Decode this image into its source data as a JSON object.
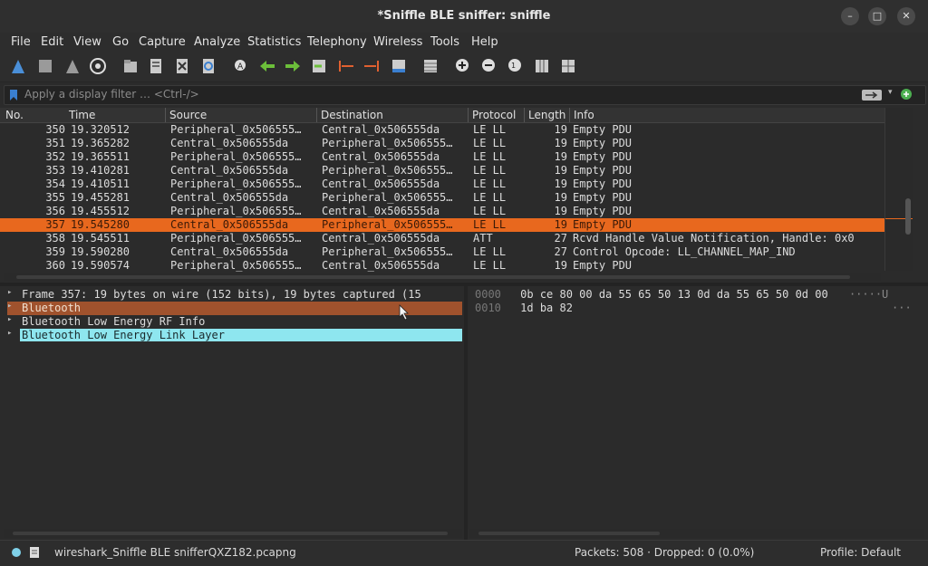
{
  "window": {
    "title": "*Sniffle BLE sniffer: sniffle"
  },
  "menu": [
    "File",
    "Edit",
    "View",
    "Go",
    "Capture",
    "Analyze",
    "Statistics",
    "Telephony",
    "Wireless",
    "Tools",
    "Help"
  ],
  "filter": {
    "placeholder": "Apply a display filter … <Ctrl-/>"
  },
  "columns": [
    "No.",
    "Time",
    "Source",
    "Destination",
    "Protocol",
    "Length",
    "Info"
  ],
  "packets": [
    {
      "no": "350",
      "time": "19.320512",
      "src": "Peripheral_0x506555…",
      "dst": "Central_0x506555da",
      "proto": "LE LL",
      "len": "19",
      "info": "Empty PDU"
    },
    {
      "no": "351",
      "time": "19.365282",
      "src": "Central_0x506555da",
      "dst": "Peripheral_0x506555…",
      "proto": "LE LL",
      "len": "19",
      "info": "Empty PDU"
    },
    {
      "no": "352",
      "time": "19.365511",
      "src": "Peripheral_0x506555…",
      "dst": "Central_0x506555da",
      "proto": "LE LL",
      "len": "19",
      "info": "Empty PDU"
    },
    {
      "no": "353",
      "time": "19.410281",
      "src": "Central_0x506555da",
      "dst": "Peripheral_0x506555…",
      "proto": "LE LL",
      "len": "19",
      "info": "Empty PDU"
    },
    {
      "no": "354",
      "time": "19.410511",
      "src": "Peripheral_0x506555…",
      "dst": "Central_0x506555da",
      "proto": "LE LL",
      "len": "19",
      "info": "Empty PDU"
    },
    {
      "no": "355",
      "time": "19.455281",
      "src": "Central_0x506555da",
      "dst": "Peripheral_0x506555…",
      "proto": "LE LL",
      "len": "19",
      "info": "Empty PDU"
    },
    {
      "no": "356",
      "time": "19.455512",
      "src": "Peripheral_0x506555…",
      "dst": "Central_0x506555da",
      "proto": "LE LL",
      "len": "19",
      "info": "Empty PDU"
    },
    {
      "no": "357",
      "time": "19.545280",
      "src": "Central_0x506555da",
      "dst": "Peripheral_0x506555…",
      "proto": "LE LL",
      "len": "19",
      "info": "Empty PDU"
    },
    {
      "no": "358",
      "time": "19.545511",
      "src": "Peripheral_0x506555…",
      "dst": "Central_0x506555da",
      "proto": "ATT",
      "len": "27",
      "info": "Rcvd Handle Value Notification, Handle: 0x0"
    },
    {
      "no": "359",
      "time": "19.590280",
      "src": "Central_0x506555da",
      "dst": "Peripheral_0x506555…",
      "proto": "LE LL",
      "len": "27",
      "info": "Control Opcode: LL_CHANNEL_MAP_IND"
    },
    {
      "no": "360",
      "time": "19.590574",
      "src": "Peripheral_0x506555…",
      "dst": "Central_0x506555da",
      "proto": "LE LL",
      "len": "19",
      "info": "Empty PDU"
    }
  ],
  "details": [
    "Frame 357: 19 bytes on wire (152 bits), 19 bytes captured (15",
    "Bluetooth",
    "Bluetooth Low Energy RF Info",
    "Bluetooth Low Energy Link Layer"
  ],
  "bytes": [
    {
      "offset": "0000",
      "hex": "0b ce 80 00 da 55 65 50  13 0d da 55 65 50 0d 00",
      "ascii": "·····U"
    },
    {
      "offset": "0010",
      "hex": "1d ba 82",
      "ascii": "···"
    }
  ],
  "status": {
    "file": "wireshark_Sniffle BLE snifferQXZ182.pcapng",
    "packets": "Packets: 508 · Dropped: 0 (0.0%)",
    "profile": "Profile: Default"
  },
  "colors": {
    "selected_row": "#e8681e",
    "bluetooth_row": "#a0522d",
    "link_layer_row": "#8ee6ef"
  }
}
